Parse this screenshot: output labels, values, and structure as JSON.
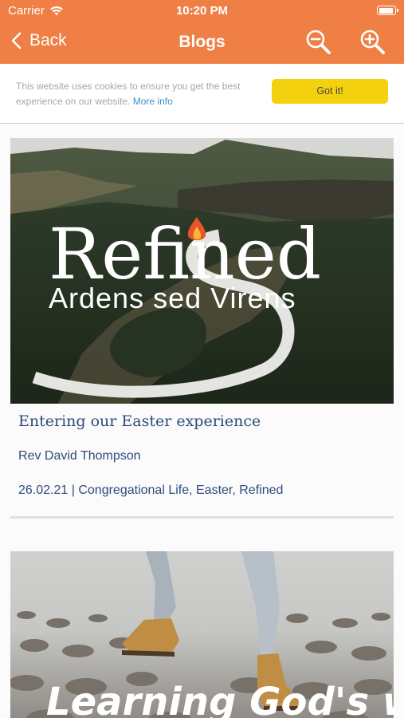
{
  "status_bar": {
    "carrier": "Carrier",
    "time": "10:20 PM",
    "battery_level": 0.95
  },
  "nav": {
    "back_label": "Back",
    "title": "Blogs",
    "icons": [
      "chevron-left-icon",
      "zoom-out-icon",
      "zoom-in-icon"
    ]
  },
  "cookie_banner": {
    "text": "This website uses cookies to ensure you get the best experience on our website.",
    "link_label": "More info",
    "button_label": "Got it!"
  },
  "posts": [
    {
      "image_title": "Refined",
      "image_subtitle": "Ardens sed Virens",
      "title": "Entering our Easter experience",
      "author": "Rev David Thompson",
      "date": "26.02.21",
      "separator": "|",
      "categories": "Congregational Life, Easter, Refined"
    },
    {
      "image_title": "Learning God's ways"
    }
  ],
  "colors": {
    "header": "#f07f45",
    "accent_button": "#f3d10e",
    "text_primary": "#2f4b7c",
    "link": "#3a8fce",
    "flame": "#e8542a"
  }
}
